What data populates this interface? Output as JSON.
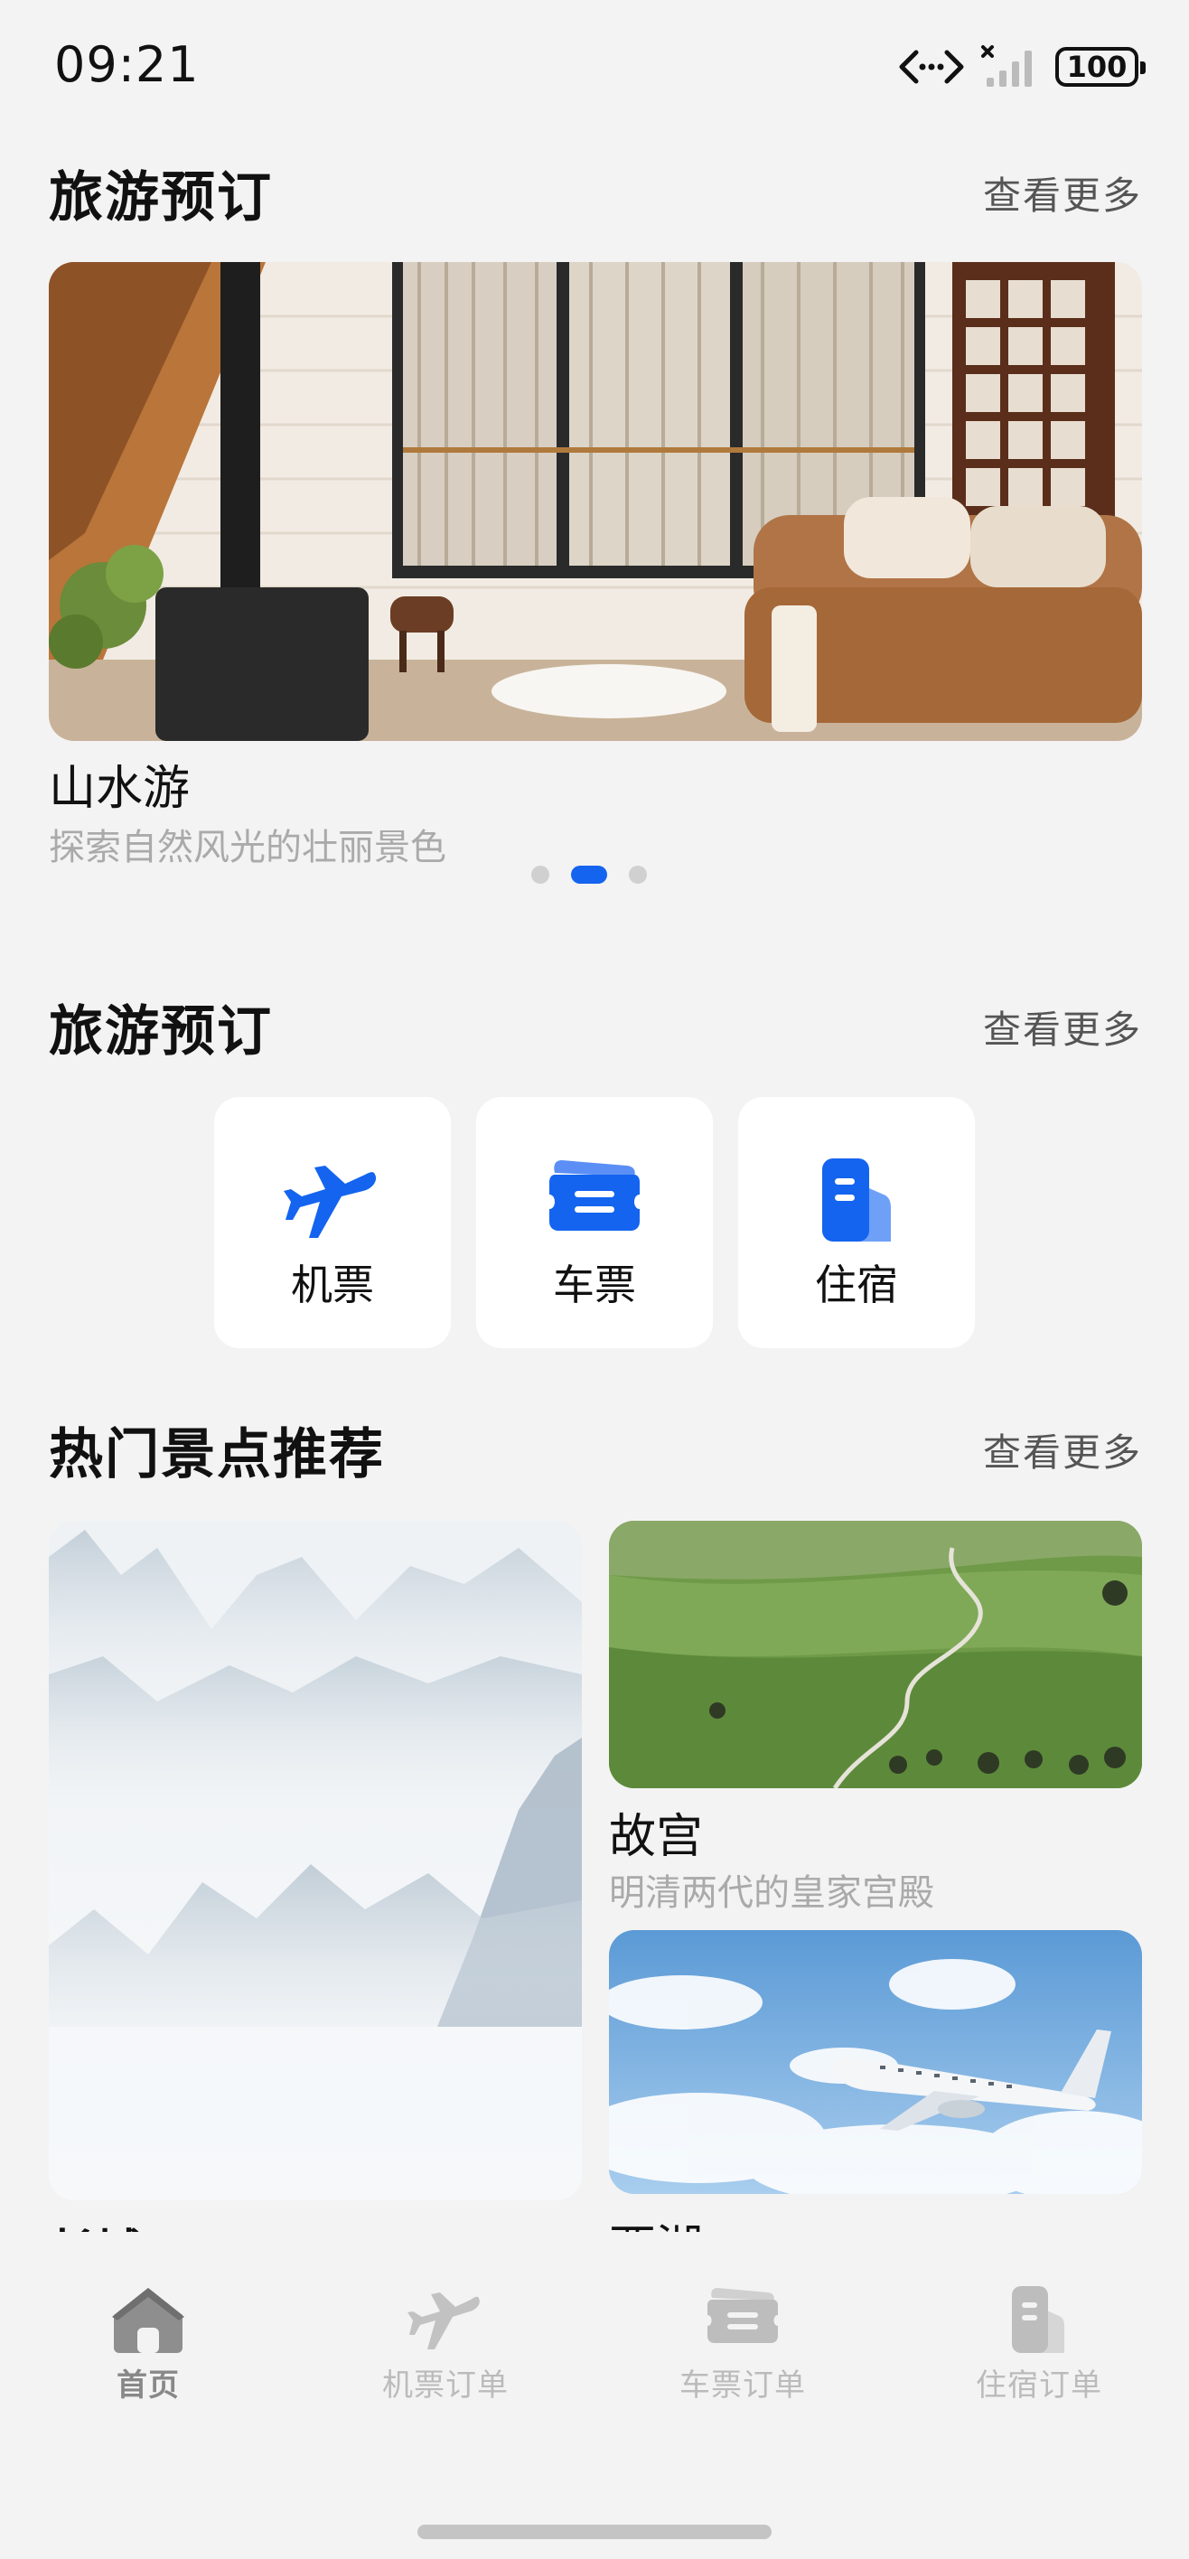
{
  "status_bar": {
    "time": "09:21",
    "battery": "100"
  },
  "sections": {
    "booking_top": {
      "title": "旅游预订",
      "more": "查看更多"
    },
    "booking": {
      "title": "旅游预订",
      "more": "查看更多"
    },
    "hot": {
      "title": "热门景点推荐",
      "more": "查看更多"
    }
  },
  "banner": {
    "title": "山水游",
    "subtitle": "探索自然风光的壮丽景色",
    "page_count": 3,
    "active_page": 2
  },
  "quick_actions": [
    {
      "label": "机票",
      "icon": "plane-icon"
    },
    {
      "label": "车票",
      "icon": "ticket-icon"
    },
    {
      "label": "住宿",
      "icon": "hotel-icon"
    }
  ],
  "spots": [
    {
      "title": "长城",
      "image": "misty-mountains"
    },
    {
      "title": "故宫",
      "subtitle": "明清两代的皇家宫殿",
      "image": "green-valley"
    },
    {
      "title": "西湖",
      "image": "airplane-sky"
    }
  ],
  "tabbar": [
    {
      "label": "首页",
      "icon": "home-icon",
      "active": true
    },
    {
      "label": "机票订单",
      "icon": "plane-icon",
      "active": false
    },
    {
      "label": "车票订单",
      "icon": "ticket-icon",
      "active": false
    },
    {
      "label": "住宿订单",
      "icon": "hotel-icon",
      "active": false
    }
  ],
  "colors": {
    "accent": "#1464f0",
    "background": "#f3f3f3",
    "card": "#ffffff",
    "muted_text": "#aaaaaa"
  }
}
